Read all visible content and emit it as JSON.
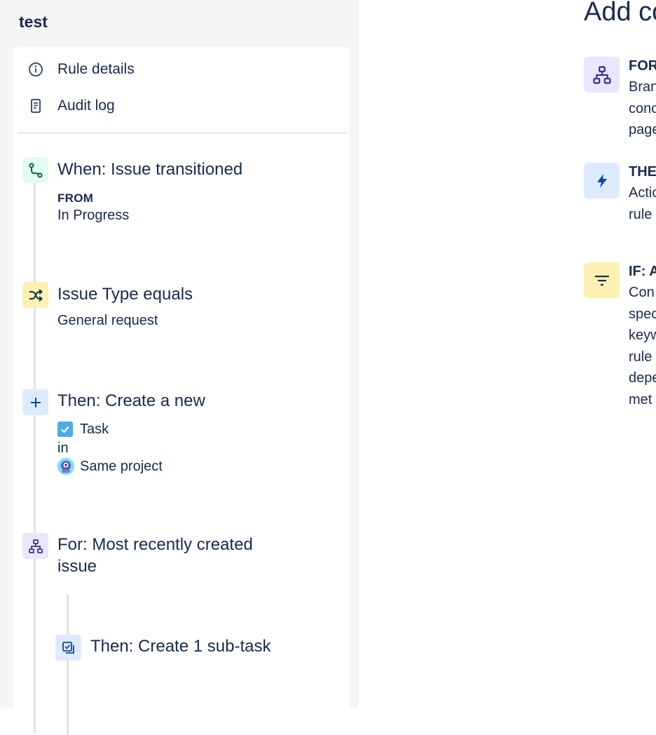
{
  "rule": {
    "name": "test"
  },
  "nav": {
    "items": [
      {
        "label": "Rule details",
        "icon": "info-icon"
      },
      {
        "label": "Audit log",
        "icon": "document-icon"
      }
    ]
  },
  "components": {
    "trigger": {
      "title": "When: Issue transitioned",
      "label": "FROM",
      "value": "In Progress",
      "icon": "transition-icon",
      "color": "#e3fcef"
    },
    "condition": {
      "title": "Issue Type equals",
      "value": "General request",
      "icon": "shuffle-icon",
      "color": "#fff0b3"
    },
    "action_create": {
      "title": "Then: Create a new",
      "issue_type": "Task",
      "connector": "in",
      "project": "Same project",
      "icon": "plus-icon",
      "color": "#deebff"
    },
    "branch": {
      "title_line1": "For: Most recently created",
      "title_line2": "issue",
      "icon": "branch-icon",
      "color": "#eae6ff"
    },
    "subtask": {
      "title": "Then: Create 1 sub-task",
      "icon": "subtask-icon",
      "color": "#deebff"
    }
  },
  "right_panel": {
    "title": "Add co",
    "options": [
      {
        "label": "FOR",
        "desc": [
          "Bran",
          "conc",
          "page"
        ],
        "icon": "branch-icon",
        "color": "#eae6ff"
      },
      {
        "label": "THE",
        "desc": [
          "Actic",
          "rule"
        ],
        "icon": "lightning-icon",
        "color": "#deebff"
      },
      {
        "label": "IF: A",
        "desc": [
          "Con",
          "spec",
          "keyw",
          "rule",
          "depe",
          "met"
        ],
        "icon": "filter-icon",
        "color": "#fff0b3"
      }
    ]
  }
}
